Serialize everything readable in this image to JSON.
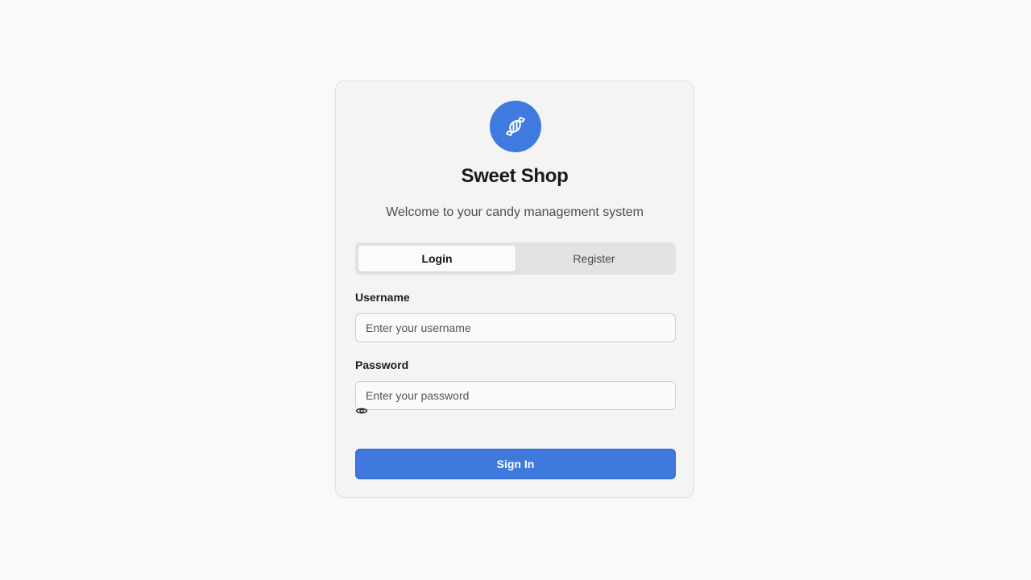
{
  "app": {
    "title": "Sweet Shop",
    "subtitle": "Welcome to your candy management system",
    "logo_icon": "candy-icon",
    "accent_color": "#3f7ade"
  },
  "tabs": [
    {
      "label": "Login",
      "active": true
    },
    {
      "label": "Register",
      "active": false
    }
  ],
  "form": {
    "username_label": "Username",
    "username_placeholder": "Enter your username",
    "username_value": "",
    "password_label": "Password",
    "password_placeholder": "Enter your password",
    "password_value": "",
    "password_toggle_icon": "eye-icon",
    "submit_label": "Sign In"
  }
}
